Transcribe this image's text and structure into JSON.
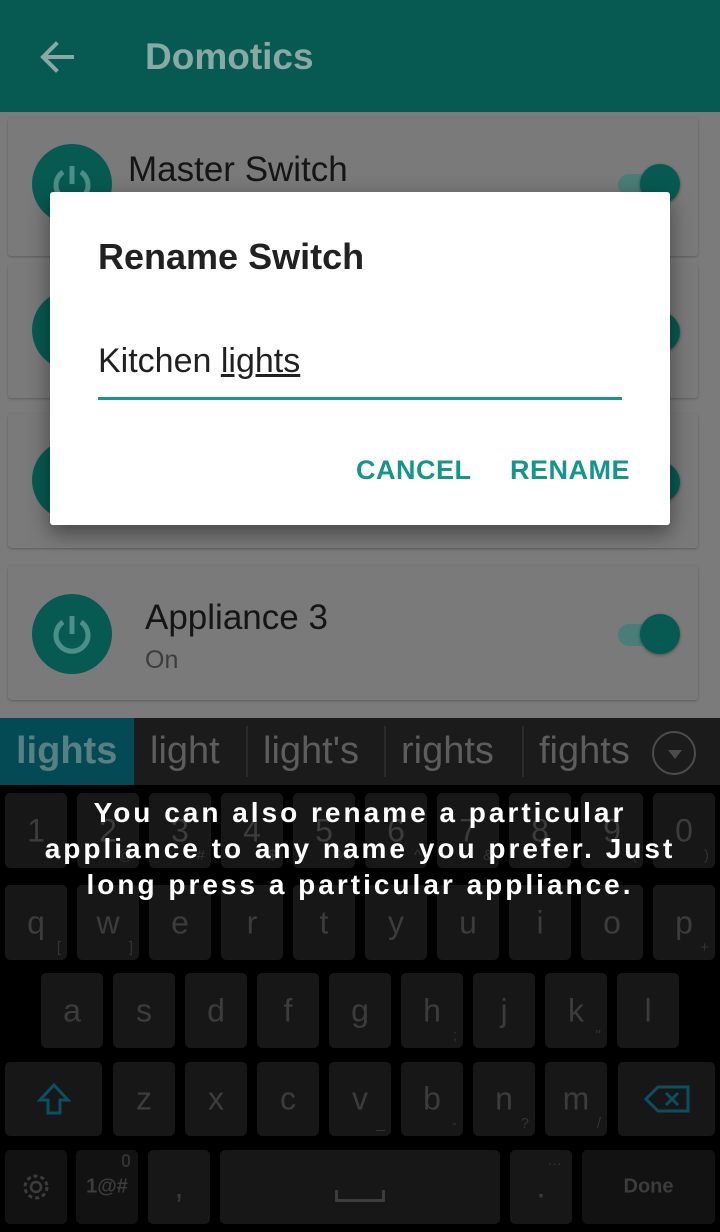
{
  "appbar": {
    "title": "Domotics"
  },
  "cards": [
    {
      "name": "Master Switch",
      "state": ""
    },
    {
      "name": "",
      "state": ""
    },
    {
      "name": "",
      "state": ""
    },
    {
      "name": "Appliance 3",
      "state": "On"
    }
  ],
  "dialog": {
    "title": "Rename Switch",
    "input_prefix": "Kitchen ",
    "input_composing": "lights",
    "cancel_label": "CANCEL",
    "rename_label": "RENAME"
  },
  "suggestions": [
    "lights",
    "light",
    "light's",
    "rights",
    "fights"
  ],
  "keyboard": {
    "row1": [
      {
        "k": "1",
        "s": "!"
      },
      {
        "k": "2",
        "s": "@"
      },
      {
        "k": "3",
        "s": "#"
      },
      {
        "k": "4",
        "s": "$"
      },
      {
        "k": "5",
        "s": "%"
      },
      {
        "k": "6",
        "s": "^"
      },
      {
        "k": "7",
        "s": "&"
      },
      {
        "k": "8",
        "s": "*"
      },
      {
        "k": "9",
        "s": "("
      },
      {
        "k": "0",
        "s": ")"
      }
    ],
    "row2": [
      {
        "k": "q",
        "s": "["
      },
      {
        "k": "w",
        "s": "]"
      },
      {
        "k": "e",
        "s": ""
      },
      {
        "k": "r",
        "s": ""
      },
      {
        "k": "t",
        "s": ""
      },
      {
        "k": "y",
        "s": ""
      },
      {
        "k": "u",
        "s": ""
      },
      {
        "k": "i",
        "s": ""
      },
      {
        "k": "o",
        "s": ""
      },
      {
        "k": "p",
        "s": "+"
      }
    ],
    "row3": [
      {
        "k": "a",
        "s": ""
      },
      {
        "k": "s",
        "s": ""
      },
      {
        "k": "d",
        "s": ""
      },
      {
        "k": "f",
        "s": ""
      },
      {
        "k": "g",
        "s": ""
      },
      {
        "k": "h",
        "s": ";"
      },
      {
        "k": "j",
        "s": ""
      },
      {
        "k": "k",
        "s": "\""
      },
      {
        "k": "l",
        "s": ""
      }
    ],
    "row4": [
      {
        "k": "z",
        "s": ""
      },
      {
        "k": "x",
        "s": ""
      },
      {
        "k": "c",
        "s": ""
      },
      {
        "k": "v",
        "s": "_"
      },
      {
        "k": "b",
        "s": "-"
      },
      {
        "k": "n",
        "s": "?"
      },
      {
        "k": "m",
        "s": "/"
      }
    ],
    "symbols_label": "1@#",
    "comma_label": ",",
    "period_label": ".",
    "done_label": "Done"
  },
  "tutorial_text": "You can also rename a particular appliance to any name you prefer. Just long press a particular appliance."
}
